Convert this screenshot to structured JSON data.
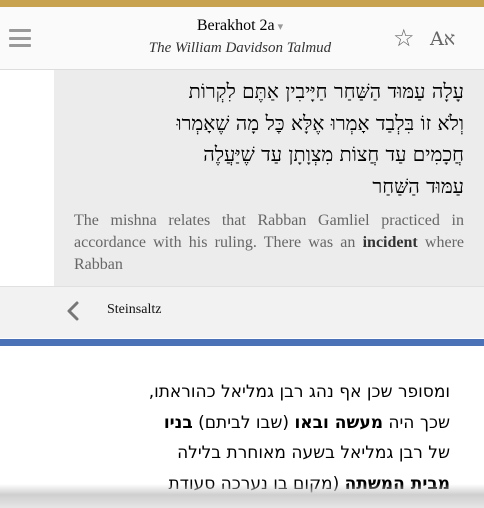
{
  "header": {
    "title": "Berakhot 2a",
    "title_caret": "▾",
    "subtitle": "The William Davidson Talmud",
    "language_toggle": "Aא",
    "icons": {
      "menu": "menu-icon",
      "bookmark": "star-icon",
      "language": "language-toggle-icon"
    }
  },
  "segment": {
    "hebrew_lines": [
      "עָלָה עַמּוּד הַשַּׁחַר חַיָּיבִין אַתֶּם לִקְרוֹת",
      "וְלֹא זוֹ בִּלְבַד אָמְרוּ אֶלָּא כׇּל מָה שֶׁאָמְרוּ",
      "חֲכָמִים עַד חֲצוֹת מִצְוָתָן עַד שֶׁיַּעֲלֶה",
      "עַמּוּד הַשַּׁחַר"
    ],
    "english_before": "The mishna relates that Rabban Gamliel practiced in accordance with his ruling. There was an ",
    "english_bold": "incident",
    "english_after": " where Rabban"
  },
  "connections": {
    "label": "Steinsaltz",
    "back_icon": "chevron-left-icon"
  },
  "commentary": {
    "line1": "ומסופר שכן אף נהג רבן גמליאל כהוראתו,",
    "line2_a": "שכך היה ",
    "line2_bold": "מעשה ובאו",
    "line2_b": " (שבו לביתם) ",
    "line2_bold2": "בניו",
    "line3": "של רבן גמליאל בשעה מאוחרת בלילה",
    "line4_bold": "מבית המשתה",
    "line4_b": " (מקום בו נערכה סעודת"
  },
  "colors": {
    "accent_top": "#c9a24f",
    "divider_blue": "#4b71b7",
    "segment_bg": "#ececec"
  }
}
